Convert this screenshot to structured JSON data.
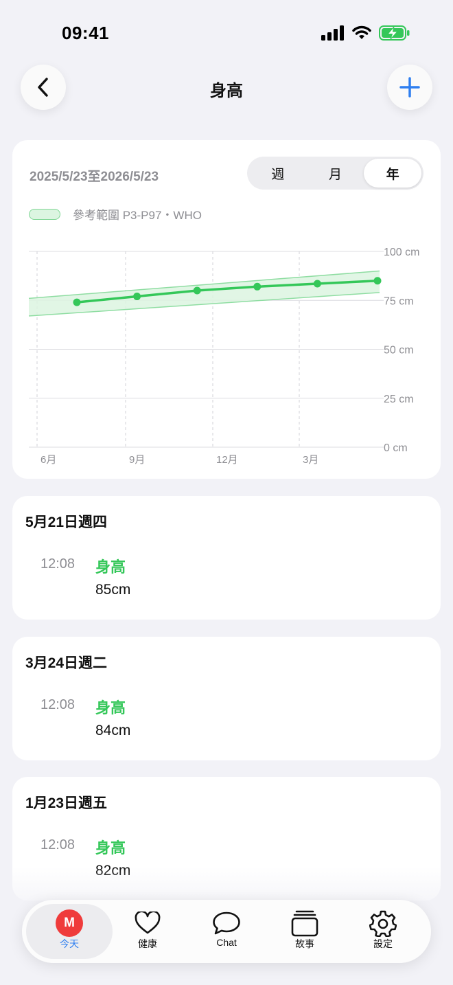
{
  "status_bar": {
    "time": "09:41"
  },
  "header": {
    "title": "身高"
  },
  "chart_card": {
    "date_range": "2025/5/23至2026/5/23",
    "segments": [
      {
        "label": "週",
        "active": false
      },
      {
        "label": "月",
        "active": false
      },
      {
        "label": "年",
        "active": true
      }
    ],
    "legend_label": "參考範圍 P3-P97・WHO"
  },
  "chart_data": {
    "type": "line",
    "x_tick_labels": [
      "6月",
      "9月",
      "12月",
      "3月"
    ],
    "y_tick_labels": [
      "100 cm",
      "75 cm",
      "50 cm",
      "25 cm",
      "0 cm"
    ],
    "ylim": [
      0,
      100
    ],
    "series": [
      {
        "values": [
          74,
          77,
          80,
          82,
          83.5,
          85
        ]
      }
    ],
    "reference_band": {
      "lower_start": 67,
      "lower_end": 79,
      "upper_start": 76,
      "upper_end": 90
    },
    "line_color": "#34c759",
    "band_color": "#dcf5e1"
  },
  "entries": [
    {
      "date": "5月21日週四",
      "time": "12:08",
      "type": "身高",
      "value": "85cm"
    },
    {
      "date": "3月24日週二",
      "time": "12:08",
      "type": "身高",
      "value": "84cm"
    },
    {
      "date": "1月23日週五",
      "time": "12:08",
      "type": "身高",
      "value": "82cm"
    }
  ],
  "tab_bar": {
    "avatar_letter": "M",
    "items": [
      {
        "label": "今天",
        "icon": "avatar",
        "active": true
      },
      {
        "label": "健康",
        "icon": "heart-icon",
        "active": false
      },
      {
        "label": "Chat",
        "icon": "chat-bubble-icon",
        "active": false
      },
      {
        "label": "故事",
        "icon": "stack-icon",
        "active": false
      },
      {
        "label": "設定",
        "icon": "gear-icon",
        "active": false
      }
    ]
  },
  "colors": {
    "accent": "#2f7ff0",
    "green": "#34c759",
    "avatar_red": "#ef3b3b"
  }
}
